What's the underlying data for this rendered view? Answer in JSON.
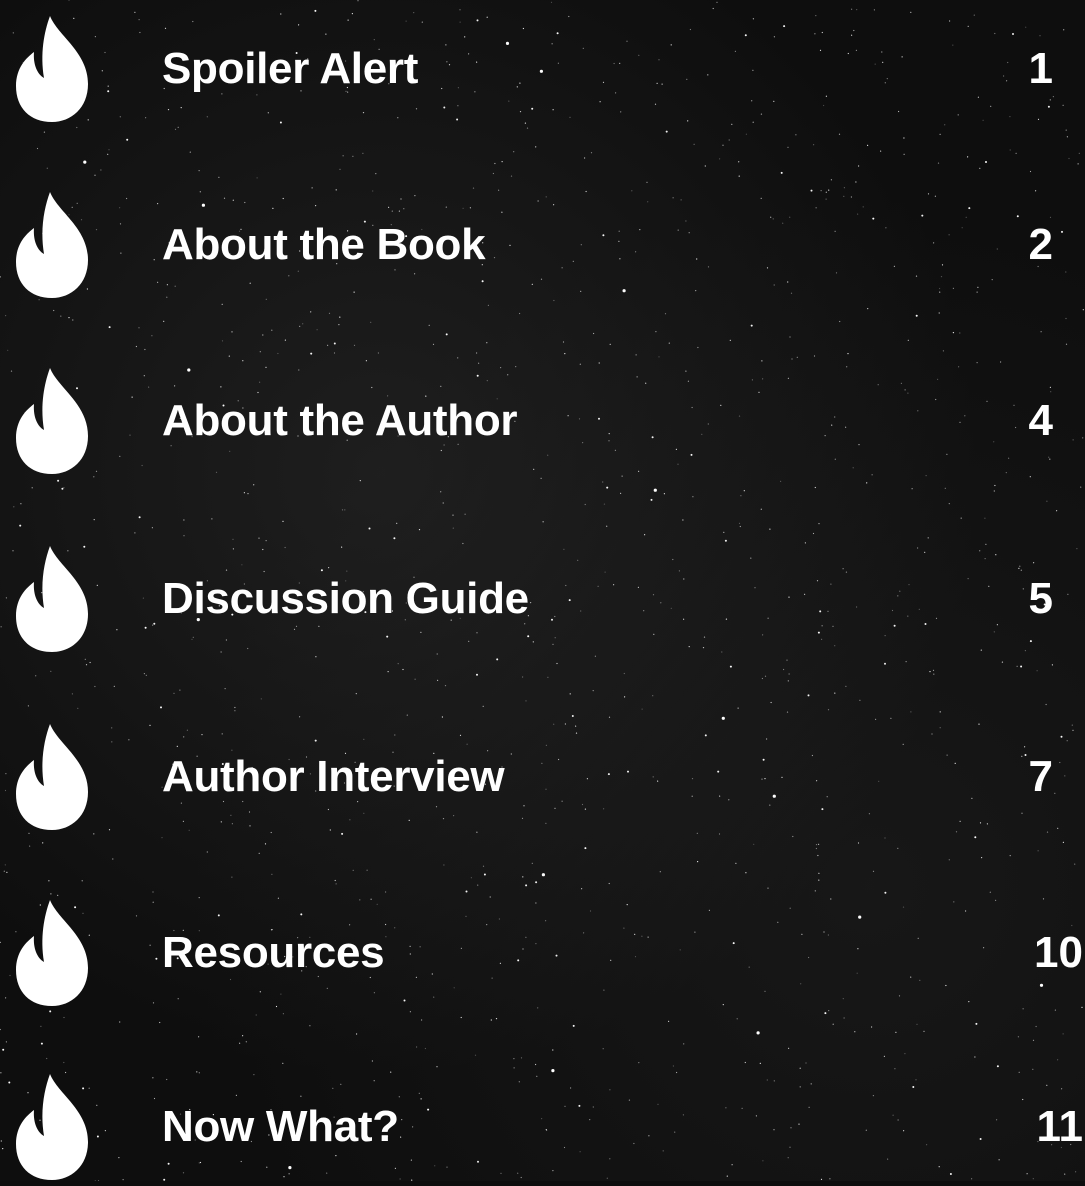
{
  "toc": {
    "items": [
      {
        "title": "Spoiler Alert",
        "page": "1",
        "icon": "flame-icon"
      },
      {
        "title": "About the Book",
        "page": "2",
        "icon": "flame-icon"
      },
      {
        "title": "About the Author",
        "page": "4",
        "icon": "flame-icon"
      },
      {
        "title": "Discussion Guide",
        "page": "5",
        "icon": "flame-icon"
      },
      {
        "title": "Author Interview",
        "page": "7",
        "icon": "flame-icon"
      },
      {
        "title": "Resources",
        "page": "10",
        "icon": "flame-icon"
      },
      {
        "title": "Now What?",
        "page": "11",
        "icon": "flame-icon"
      }
    ]
  },
  "colors": {
    "background": "#0e0e0e",
    "text": "#ffffff",
    "icon": "#ffffff"
  }
}
